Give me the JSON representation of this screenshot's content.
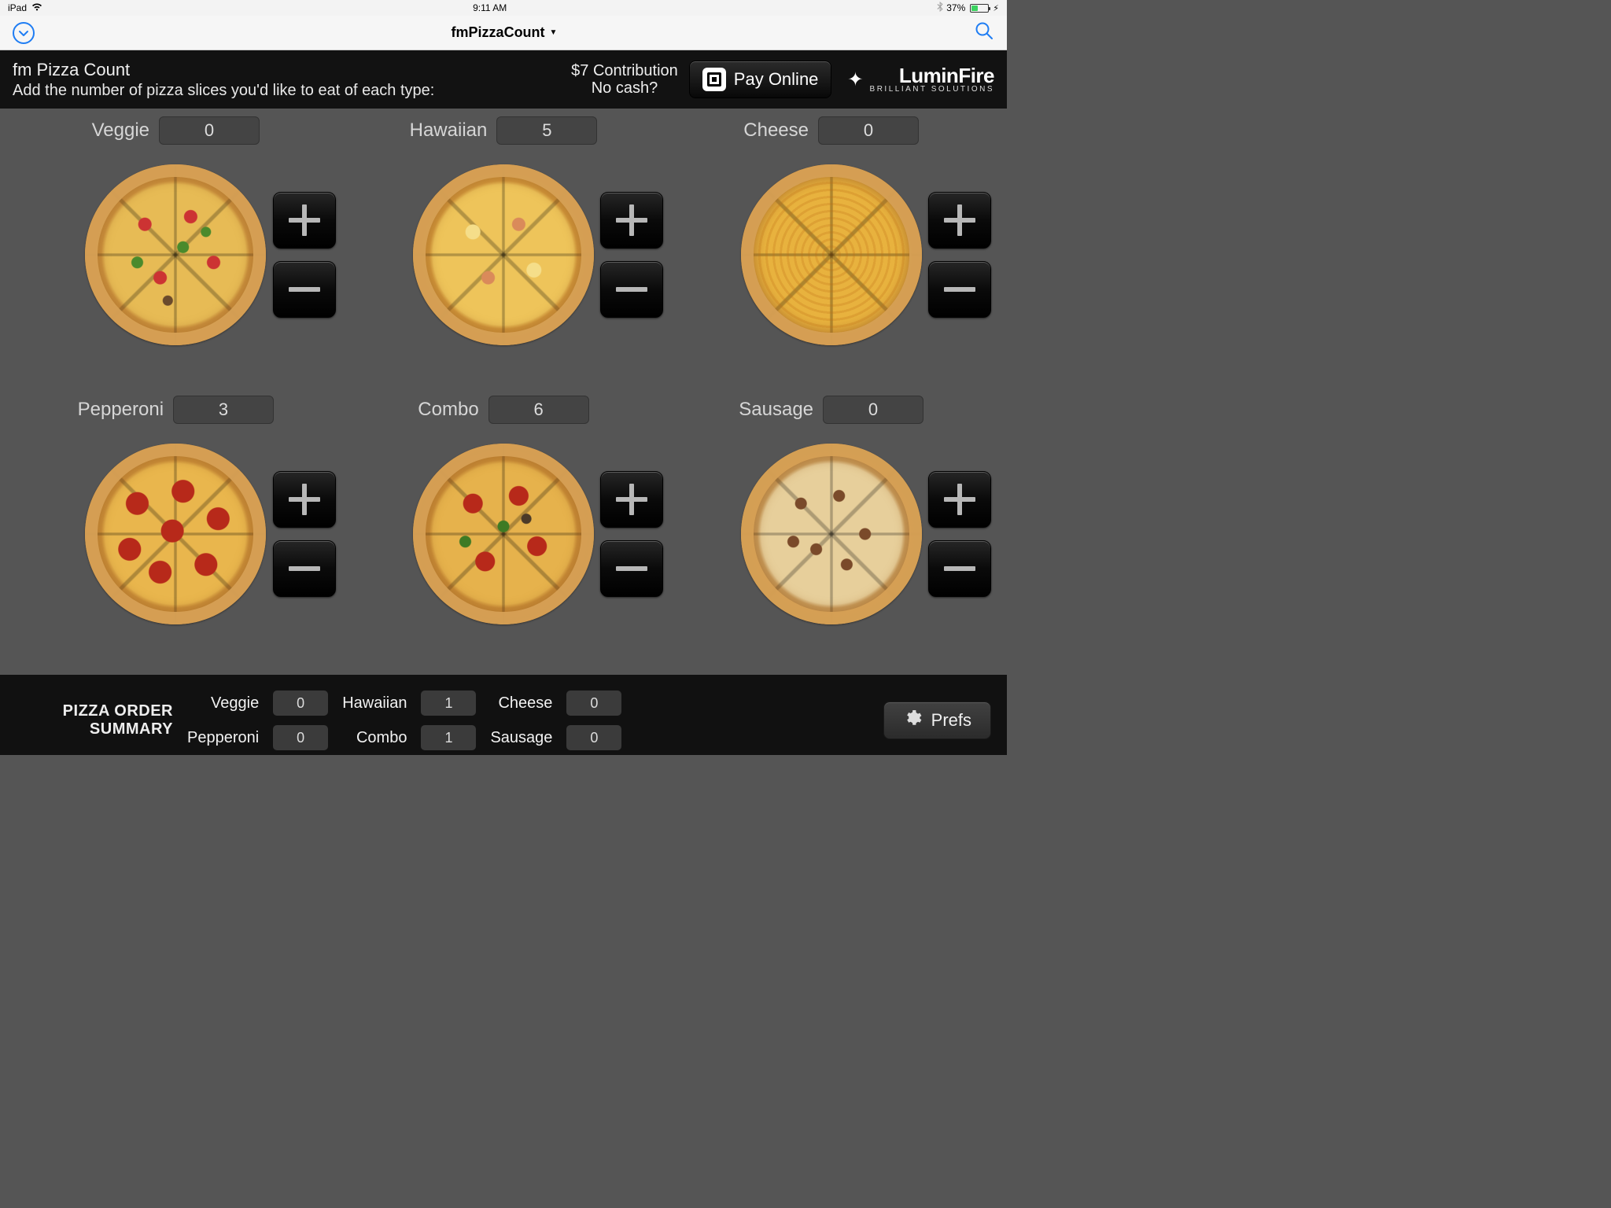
{
  "status": {
    "device": "iPad",
    "time": "9:11 AM",
    "battery_pct": "37%"
  },
  "nav": {
    "title": "fmPizzaCount"
  },
  "header": {
    "title": "fm Pizza Count",
    "subtitle": "Add the number of pizza slices you'd like to eat of each type:",
    "contribution_line1": "$7 Contribution",
    "contribution_line2": "No cash?",
    "pay_label": "Pay Online",
    "logo_main": "LuminFire",
    "logo_sub": "BRILLIANT SOLUTIONS"
  },
  "pizzas": [
    {
      "label": "Veggie",
      "count": "0",
      "class": "pizza-veggie"
    },
    {
      "label": "Hawaiian",
      "count": "5",
      "class": "pizza-hawaiian"
    },
    {
      "label": "Cheese",
      "count": "0",
      "class": "pizza-cheese"
    },
    {
      "label": "Pepperoni",
      "count": "3",
      "class": "pizza-pepperoni"
    },
    {
      "label": "Combo",
      "count": "6",
      "class": "pizza-combo"
    },
    {
      "label": "Sausage",
      "count": "0",
      "class": "pizza-sausage"
    }
  ],
  "summary": {
    "title_line1": "PIZZA ORDER",
    "title_line2": "SUMMARY",
    "items": [
      {
        "label": "Veggie",
        "value": "0"
      },
      {
        "label": "Hawaiian",
        "value": "1"
      },
      {
        "label": "Cheese",
        "value": "0"
      },
      {
        "label": "Pepperoni",
        "value": "0"
      },
      {
        "label": "Combo",
        "value": "1"
      },
      {
        "label": "Sausage",
        "value": "0"
      }
    ],
    "prefs_label": "Prefs"
  }
}
